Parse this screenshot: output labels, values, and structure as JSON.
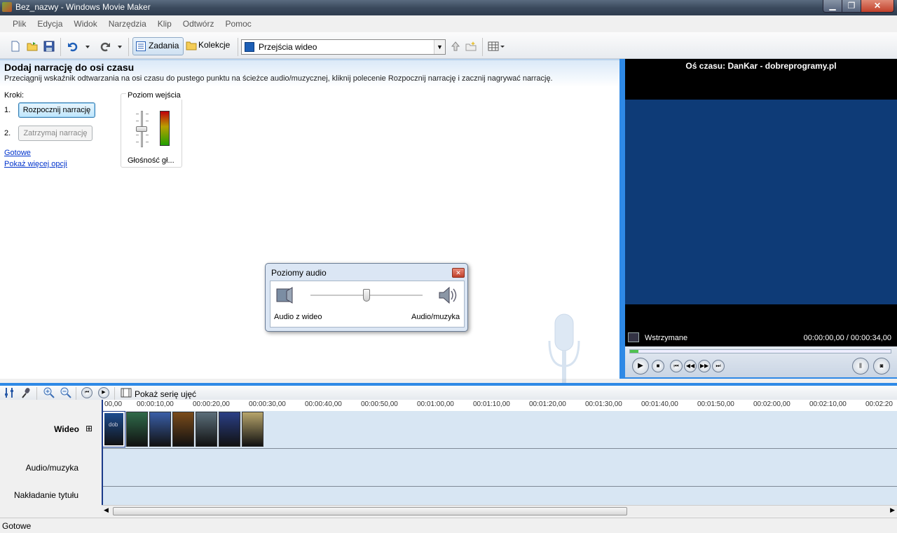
{
  "window": {
    "title": "Bez_nazwy - Windows Movie Maker",
    "min_label": "▁",
    "max_label": "❐",
    "close_label": "✕"
  },
  "menu": [
    "Plik",
    "Edycja",
    "Widok",
    "Narzędzia",
    "Klip",
    "Odtwórz",
    "Pomoc"
  ],
  "toolbar": {
    "tasks_label": "Zadania",
    "collections_label": "Kolekcje",
    "combo_value": "Przejścia wideo"
  },
  "task": {
    "title": "Dodaj narrację do osi czasu",
    "description": "Przeciągnij wskaźnik odtwarzania na osi czasu do pustego punktu na ścieżce audio/muzycznej, kliknij polecenie Rozpocznij narrację i zacznij nagrywać narrację.",
    "steps_label": "Kroki:",
    "step1_num": "1.",
    "step2_num": "2.",
    "start_button": "Rozpocznij narrację",
    "stop_button": "Zatrzymaj narrację",
    "done_link": "Gotowe",
    "more_link": "Pokaż więcej opcji",
    "level_title": "Poziom wejścia",
    "volume_label": "Głośność gł...",
    "input_level": 0.45,
    "vu_level": 1.0
  },
  "audio_dialog": {
    "title": "Poziomy audio",
    "left_label": "Audio z wideo",
    "right_label": "Audio/muzyka",
    "balance": 0.5
  },
  "monitor": {
    "title": "Oś czasu: DanKar - dobreprogramy.pl",
    "status": "Wstrzymane",
    "time": "00:00:00,00 / 00:00:34,00",
    "progress": 0.0
  },
  "timeline": {
    "storyboard_label": "Pokaż serię ujęć",
    "ruler": [
      "00,00",
      "00:00:10,00",
      "00:00:20,00",
      "00:00:30,00",
      "00:00:40,00",
      "00:00:50,00",
      "00:01:00,00",
      "00:01:10,00",
      "00:01:20,00",
      "00:01:30,00",
      "00:01:40,00",
      "00:01:50,00",
      "00:02:00,00",
      "00:02:10,00",
      "00:02:20"
    ],
    "tracks": {
      "video": "Wideo",
      "audio": "Audio/muzyka",
      "title": "Nakładanie tytułu"
    },
    "expand_label": "⊞",
    "first_clip_text": "dob",
    "clips": [
      "#1d4c8f",
      "#2f6a4a",
      "#3a5fa8",
      "#7a4b1b",
      "#5b6e7a",
      "#2a3f86",
      "#b7a56b"
    ]
  },
  "status_bar": {
    "text": "Gotowe"
  }
}
